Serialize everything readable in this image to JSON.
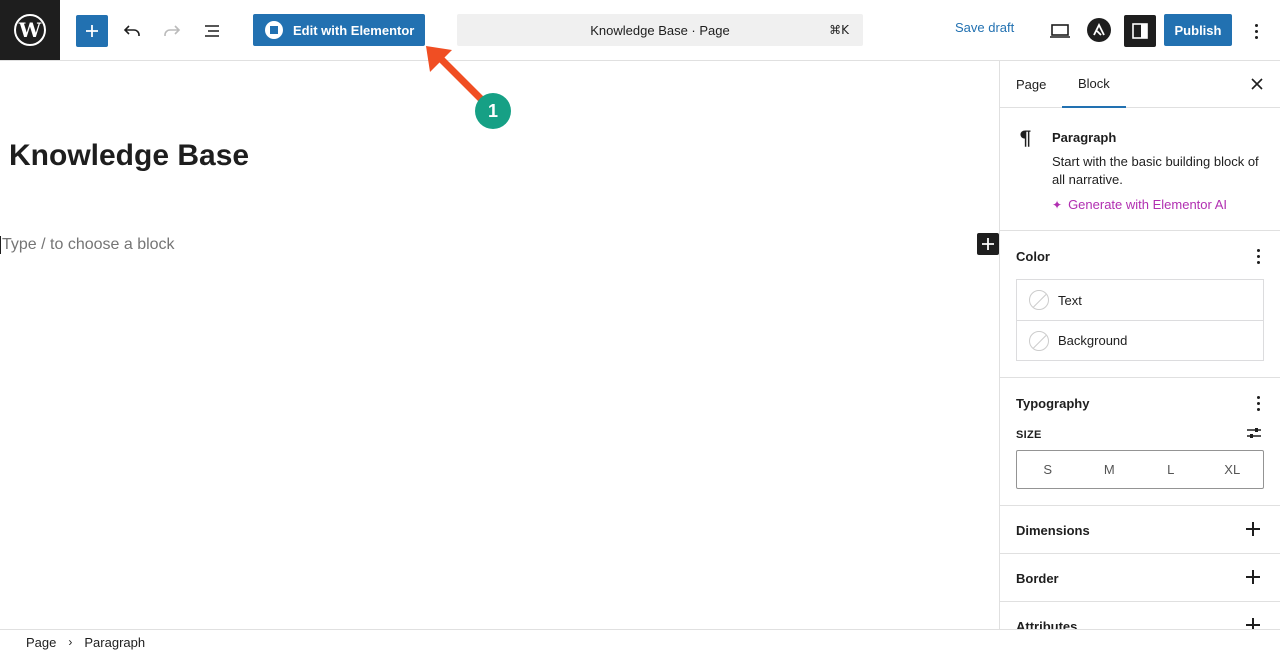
{
  "topbar": {
    "logo_icon": "wordpress-logo",
    "elementor_label": "Edit with Elementor",
    "command_bar_label": "Knowledge Base · Page",
    "command_shortcut": "⌘K",
    "save_draft_label": "Save draft",
    "publish_label": "Publish"
  },
  "editor": {
    "title": "Knowledge Base",
    "placeholder": "Type / to choose a block"
  },
  "annotation": {
    "badge": "1",
    "arrow_color": "#f04e23",
    "badge_color": "#16a085"
  },
  "sidebar": {
    "tabs": [
      "Page",
      "Block"
    ],
    "active_tab": "Block",
    "block": {
      "name": "Paragraph",
      "description": "Start with the basic building block of all narrative.",
      "ai_link": "Generate with Elementor AI"
    },
    "color": {
      "title": "Color",
      "items": [
        "Text",
        "Background"
      ]
    },
    "typography": {
      "title": "Typography",
      "size_label": "SIZE",
      "sizes": [
        "S",
        "M",
        "L",
        "XL"
      ]
    },
    "panels": [
      "Dimensions",
      "Border",
      "Attributes"
    ]
  },
  "breadcrumb": [
    "Page",
    "Paragraph"
  ],
  "colors": {
    "accent": "#2271b1",
    "dark": "#1e1e1e",
    "ai_purple": "#b12fb1"
  }
}
